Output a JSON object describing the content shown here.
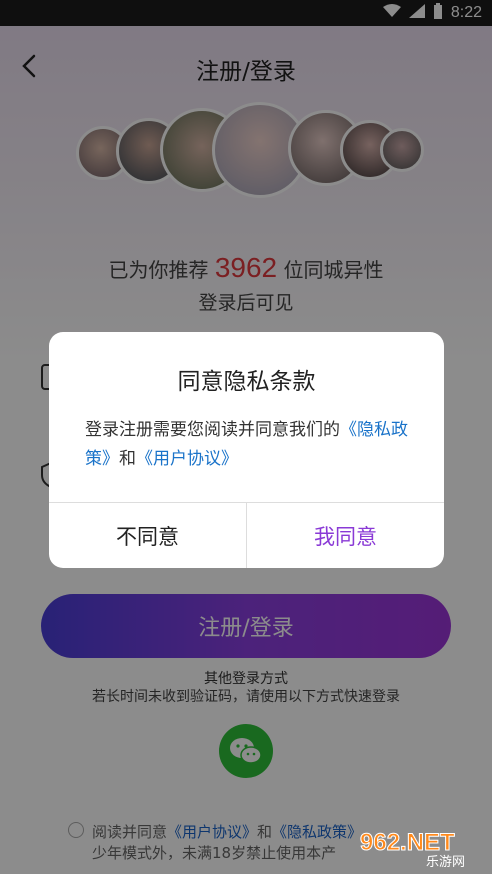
{
  "status_bar": {
    "time": "8:22"
  },
  "header": {
    "title": "注册/登录"
  },
  "recommend": {
    "prefix": "已为你推荐",
    "count": "3962",
    "suffix": "位同城异性",
    "line2": "登录后可见"
  },
  "main_button": {
    "label": "注册/登录"
  },
  "other_login": {
    "title": "其他登录方式",
    "hint": "若长时间未收到验证码，请使用以下方式快速登录"
  },
  "agreement": {
    "prefix": "阅读并同意",
    "user_agreement": "《用户协议》",
    "and": "和",
    "privacy_policy": "《隐私政策》",
    "line2": "少年模式外，未满18岁禁止使用本产"
  },
  "dialog": {
    "title": "同意隐私条款",
    "body_text": "登录注册需要您阅读并同意我们的",
    "privacy_link": "《隐私政策》",
    "and": "和",
    "user_link": "《用户协议》",
    "decline_label": "不同意",
    "accept_label": "我同意"
  },
  "watermark": {
    "text": "962.NET",
    "sub": "乐游网"
  },
  "colors": {
    "accent_purple": "#8a3ad6",
    "link_blue": "#1a73c9",
    "count_red": "#e0393e",
    "wechat_green": "#2fbf39"
  }
}
